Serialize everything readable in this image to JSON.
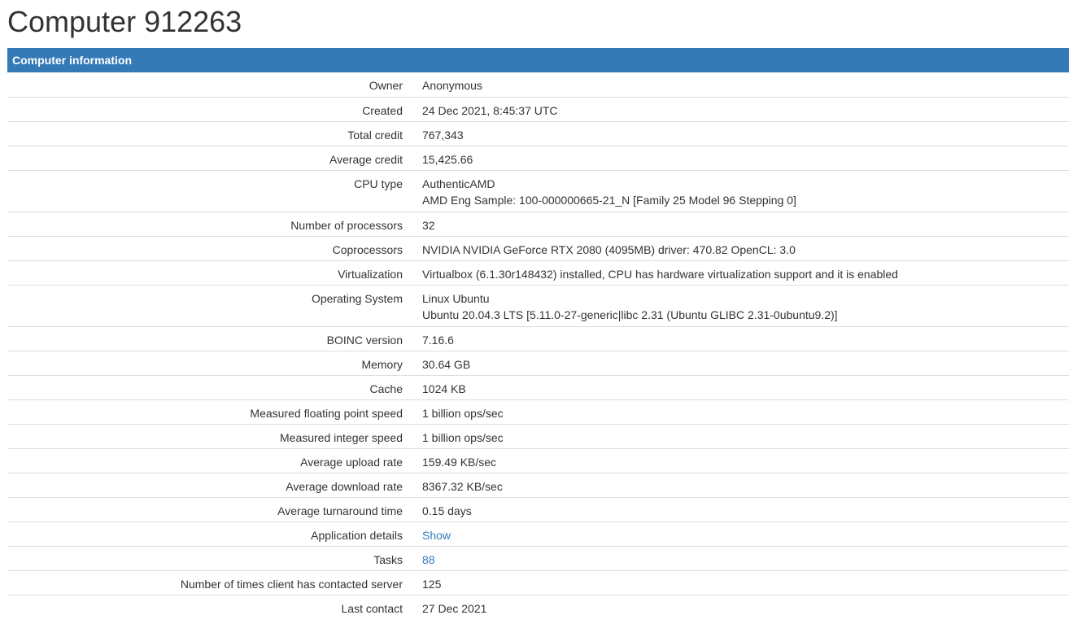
{
  "page": {
    "title": "Computer 912263"
  },
  "panel": {
    "header": "Computer information"
  },
  "rows": {
    "owner": {
      "label": "Owner",
      "value": "Anonymous"
    },
    "created": {
      "label": "Created",
      "value": "24 Dec 2021, 8:45:37 UTC"
    },
    "total_credit": {
      "label": "Total credit",
      "value": "767,343"
    },
    "average_credit": {
      "label": "Average credit",
      "value": "15,425.66"
    },
    "cpu_type": {
      "label": "CPU type",
      "value_line1": "AuthenticAMD",
      "value_line2": "AMD Eng Sample: 100-000000665-21_N [Family 25 Model 96 Stepping 0]"
    },
    "num_processors": {
      "label": "Number of processors",
      "value": "32"
    },
    "coprocessors": {
      "label": "Coprocessors",
      "value": "NVIDIA NVIDIA GeForce RTX 2080 (4095MB) driver: 470.82 OpenCL: 3.0"
    },
    "virtualization": {
      "label": "Virtualization",
      "value": "Virtualbox (6.1.30r148432) installed, CPU has hardware virtualization support and it is enabled"
    },
    "os": {
      "label": "Operating System",
      "value_line1": "Linux Ubuntu",
      "value_line2": "Ubuntu 20.04.3 LTS [5.11.0-27-generic|libc 2.31 (Ubuntu GLIBC 2.31-0ubuntu9.2)]"
    },
    "boinc_version": {
      "label": "BOINC version",
      "value": "7.16.6"
    },
    "memory": {
      "label": "Memory",
      "value": "30.64 GB"
    },
    "cache": {
      "label": "Cache",
      "value": "1024 KB"
    },
    "fp_speed": {
      "label": "Measured floating point speed",
      "value": "1 billion ops/sec"
    },
    "int_speed": {
      "label": "Measured integer speed",
      "value": "1 billion ops/sec"
    },
    "upload_rate": {
      "label": "Average upload rate",
      "value": "159.49 KB/sec"
    },
    "download_rate": {
      "label": "Average download rate",
      "value": "8367.32 KB/sec"
    },
    "turnaround": {
      "label": "Average turnaround time",
      "value": "0.15 days"
    },
    "app_details": {
      "label": "Application details",
      "link": "Show"
    },
    "tasks": {
      "label": "Tasks",
      "link": "88"
    },
    "contacts": {
      "label": "Number of times client has contacted server",
      "value": "125"
    },
    "last_contact": {
      "label": "Last contact",
      "value": "27 Dec 2021"
    }
  },
  "colors": {
    "header_bg": "#337ab7",
    "link": "#337ab7",
    "row_border": "#dddddd"
  }
}
